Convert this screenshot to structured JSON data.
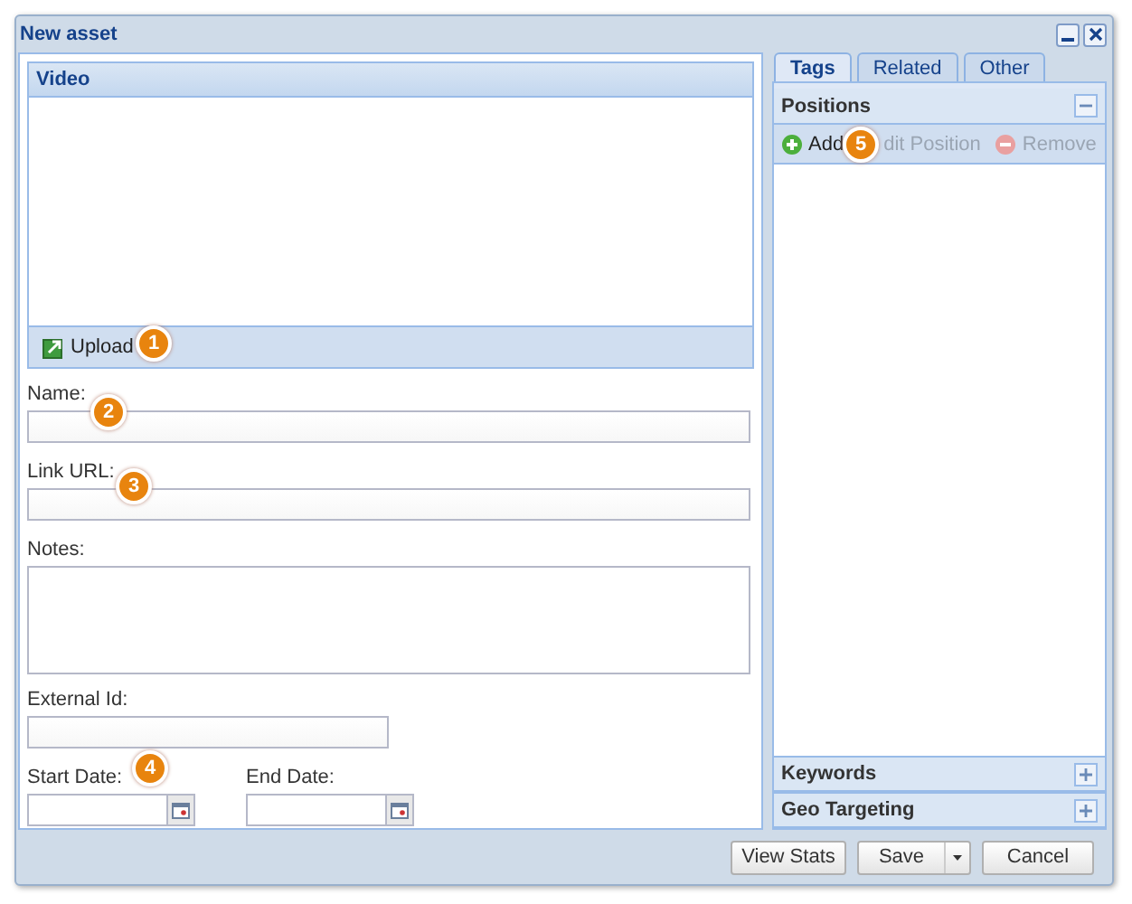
{
  "window": {
    "title": "New asset"
  },
  "video": {
    "title": "Video",
    "upload": "Upload"
  },
  "fields": [
    {
      "kind": "text",
      "label": "Name:"
    },
    {
      "kind": "text",
      "label": "Link URL:"
    },
    {
      "kind": "textarea",
      "label": "Notes:"
    },
    {
      "kind": "short",
      "label": "External Id:"
    }
  ],
  "date_fields": [
    {
      "label": "Start Date:"
    },
    {
      "label": "End Date:"
    }
  ],
  "tabs": [
    {
      "label": "Tags",
      "selected": true
    },
    {
      "label": "Related",
      "selected": false
    },
    {
      "label": "Other",
      "selected": false
    }
  ],
  "positions": {
    "title": "Positions",
    "expanded": true,
    "toolbar": [
      {
        "kind": "add",
        "label": "Add",
        "disabled": false
      },
      {
        "kind": "edit",
        "label": "dit Position",
        "disabled": true
      },
      {
        "kind": "remove",
        "label": "Remove",
        "disabled": true
      }
    ]
  },
  "sections": [
    {
      "title": "Keywords",
      "expanded": false
    },
    {
      "title": "Geo Targeting",
      "expanded": false
    }
  ],
  "buttons": [
    {
      "kind": "plain",
      "label": "View Stats"
    },
    {
      "kind": "split",
      "label": "Save"
    },
    {
      "kind": "plain",
      "label": "Cancel"
    }
  ],
  "callouts": [
    "1",
    "2",
    "3",
    "4",
    "5"
  ]
}
